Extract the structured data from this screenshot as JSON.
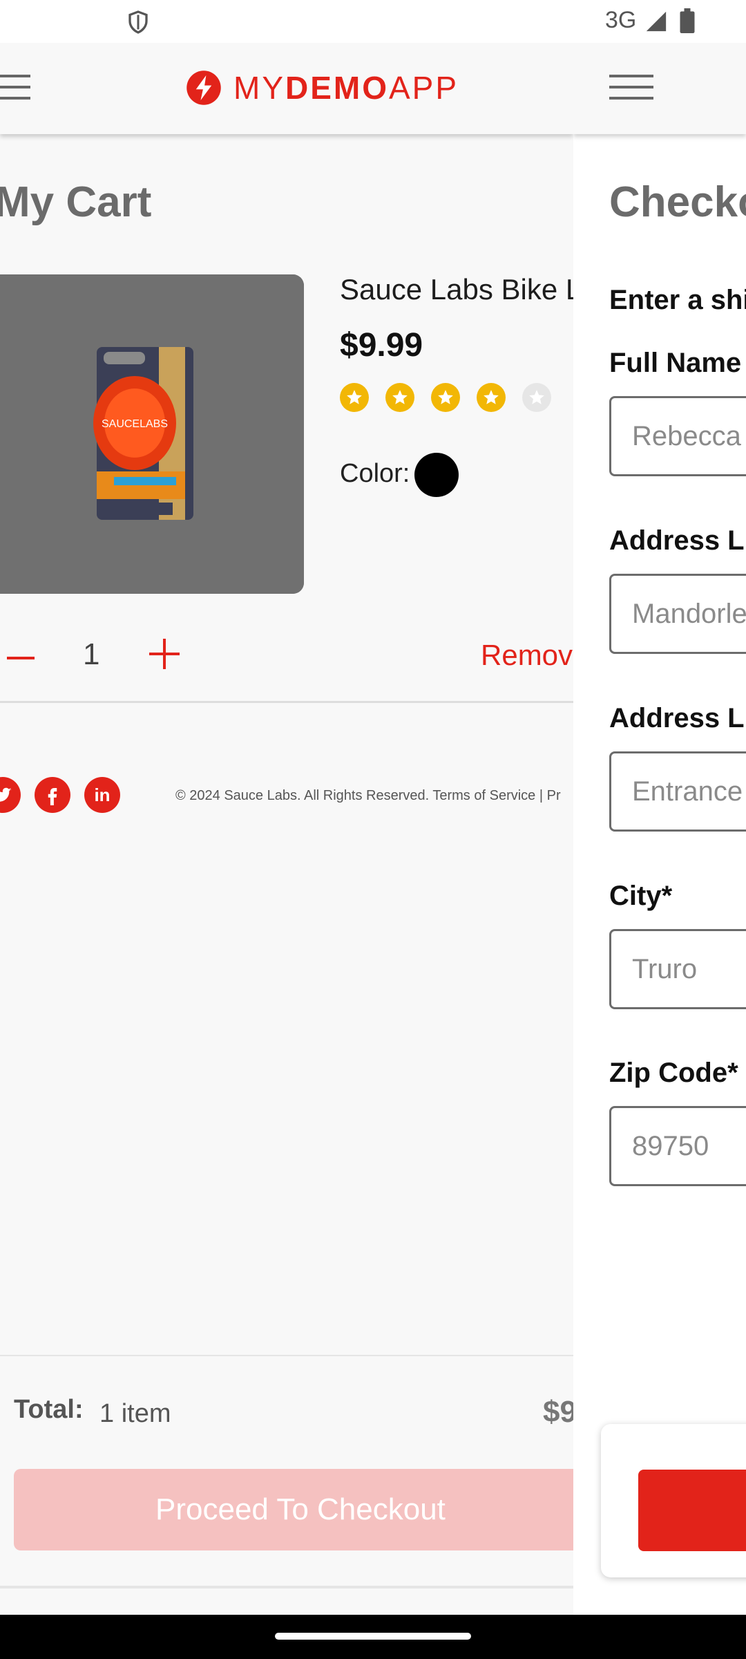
{
  "status_bar": {
    "network": "3G",
    "icons": [
      "shield-icon",
      "signal-icon",
      "battery-icon"
    ]
  },
  "app": {
    "logo_prefix": "MY",
    "logo_bold": "DEMO",
    "logo_suffix": "APP",
    "brand_color": "#e2231a"
  },
  "cart": {
    "title": "My Cart",
    "product": {
      "name": "Sauce Labs Bike L",
      "price": "$9.99",
      "rating": {
        "value": 4,
        "max": 5
      },
      "color_label": "Color:",
      "color_value": "#000000",
      "quantity": "1",
      "remove_label": "Remov"
    },
    "social": [
      "twitter-icon",
      "facebook-icon",
      "linkedin-icon"
    ],
    "copyright": "© 2024 Sauce Labs. All Rights Reserved. Terms of Service | Pr",
    "total_label": "Total:",
    "total_items": "1 item",
    "total_price": "$9",
    "checkout_button": "Proceed To Checkout"
  },
  "checkout": {
    "title": "Checko",
    "shipping_heading": "Enter a shi",
    "fields": [
      {
        "label": "Full Name",
        "value": "Rebecca"
      },
      {
        "label": "Address Li",
        "value": "Mandorle"
      },
      {
        "label": "Address Li",
        "value": "Entrance"
      },
      {
        "label": "City*",
        "value": "Truro"
      },
      {
        "label": "Zip Code*",
        "value": "89750"
      }
    ]
  }
}
